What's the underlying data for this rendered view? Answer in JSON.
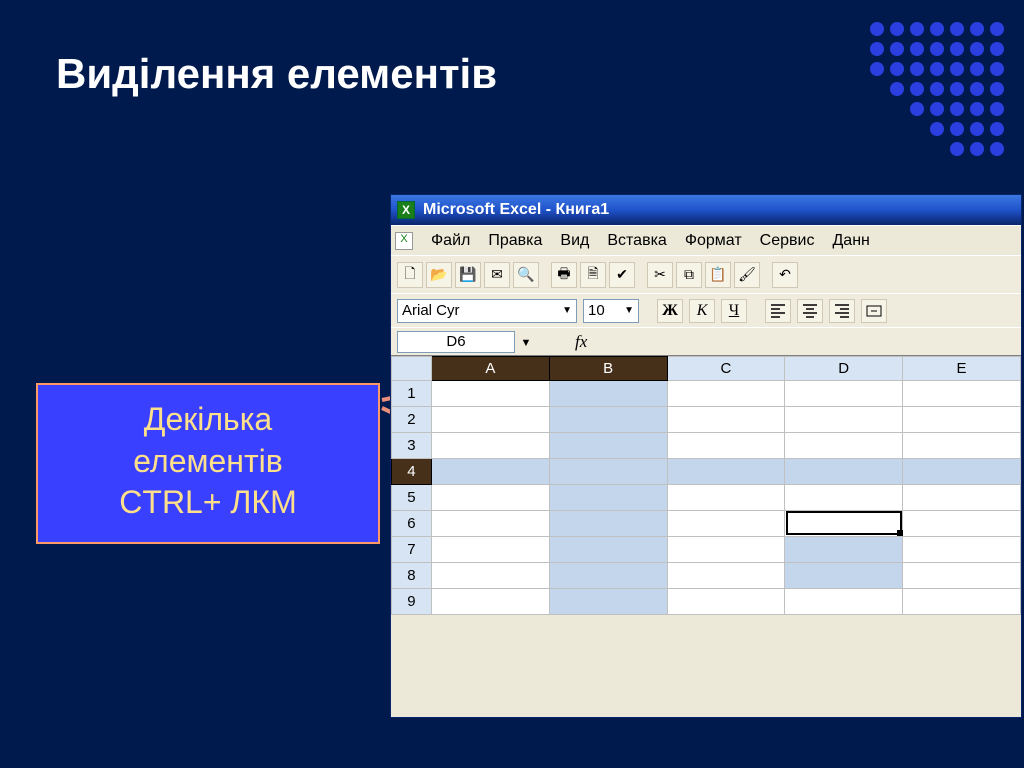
{
  "slide": {
    "title": "Виділення елементів",
    "callout_l1": "Декілька",
    "callout_l2": "елементів",
    "callout_l3": "CTRL+ ЛКМ"
  },
  "excel": {
    "title": "Microsoft Excel - Книга1",
    "menus": {
      "file": "Файл",
      "edit": "Правка",
      "view": "Вид",
      "insert": "Вставка",
      "format": "Формат",
      "service": "Сервис",
      "data": "Данн"
    },
    "font_name": "Arial Cyr",
    "font_size": "10",
    "bold": "Ж",
    "italic": "К",
    "under": "Ч",
    "namebox": "D6",
    "fx": "fx",
    "columns": [
      "A",
      "B",
      "C",
      "D",
      "E"
    ],
    "rows": [
      "1",
      "2",
      "3",
      "4",
      "5",
      "6",
      "7",
      "8",
      "9"
    ],
    "selected_col_headers": [
      "A",
      "B"
    ],
    "selected_row_headers": [
      "4"
    ],
    "selected_cells": [
      "B1",
      "B2",
      "B3",
      "B5",
      "B6",
      "B7",
      "B8",
      "B9",
      "A4",
      "B4",
      "C4",
      "D4",
      "E4",
      "D7",
      "D8"
    ],
    "active_cell": "D6"
  }
}
